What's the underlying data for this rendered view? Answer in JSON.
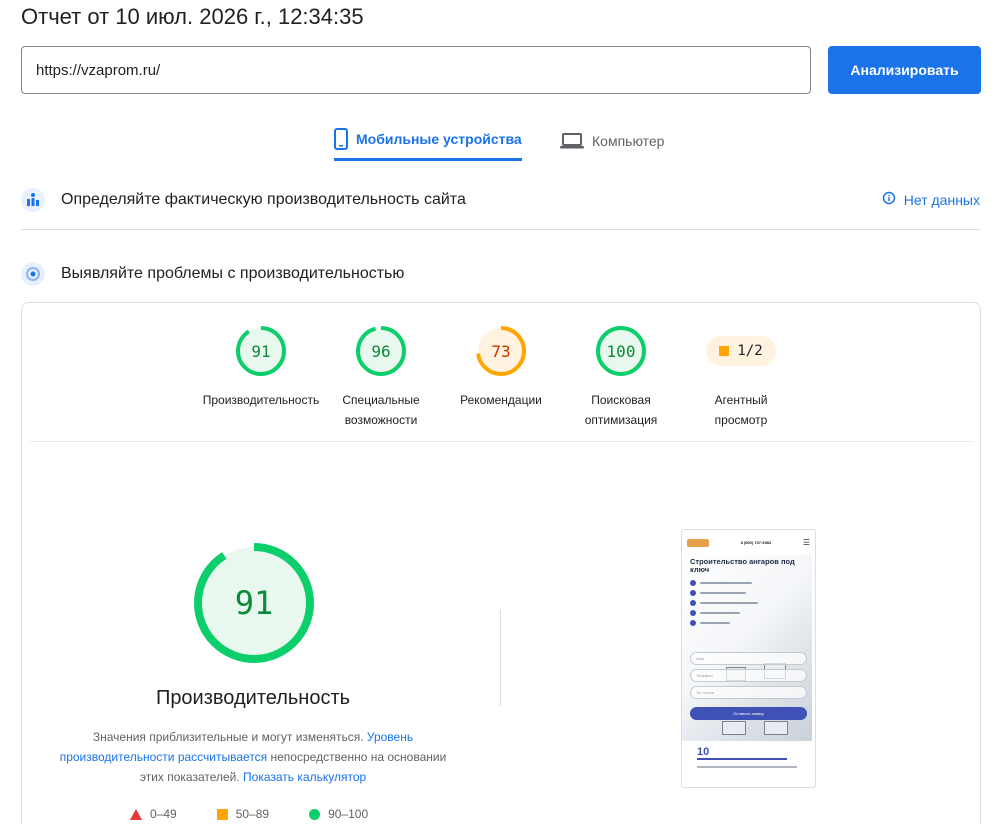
{
  "report": {
    "title": "Отчет от 10 июл. 2026 г., 12:34:35"
  },
  "search": {
    "url": "https://vzaprom.ru/",
    "analyze_label": "Анализировать"
  },
  "tabs": [
    {
      "label": "Мобильные устройства",
      "icon": "smartphone-icon",
      "active": true
    },
    {
      "label": "Компьютер",
      "icon": "laptop-icon",
      "active": false
    }
  ],
  "field_data": {
    "title": "Определяйте фактическую производительность сайта",
    "status": "Нет данных"
  },
  "lab_data": {
    "title": "Выявляйте проблемы с производительностью"
  },
  "scores": [
    {
      "value": "91",
      "label_lines": [
        "Производительность"
      ],
      "score": 91,
      "color": "#0cce6b",
      "text_color": "#0a8a3a",
      "bg": "#e8f8ee"
    },
    {
      "value": "96",
      "label_lines": [
        "Специальные",
        "возможности"
      ],
      "score": 96,
      "color": "#0cce6b",
      "text_color": "#0a8a3a",
      "bg": "#e8f8ee"
    },
    {
      "value": "73",
      "label_lines": [
        "Рекомендации"
      ],
      "score": 73,
      "color": "#ffa400",
      "text_color": "#c33300",
      "bg": "#fff3e0"
    },
    {
      "value": "100",
      "label_lines": [
        "Поисковая",
        "оптимизация"
      ],
      "score": 100,
      "color": "#0cce6b",
      "text_color": "#0a8a3a",
      "bg": "#e8f8ee"
    }
  ],
  "agent": {
    "value": "1/2",
    "label_lines": [
      "Агентный",
      "просмотр"
    ]
  },
  "performance": {
    "score": "91",
    "score_num": 91,
    "title": "Производительность",
    "note_text1": "Значения приблизительные и могут изменяться. ",
    "note_link1": "Уровень производительности рассчитывается",
    "note_text2": " непосредственно на основании этих показателей. ",
    "note_link2": "Показать калькулятор"
  },
  "legend": [
    {
      "label": "0–49",
      "shape": "triangle",
      "color": "#e53935"
    },
    {
      "label": "50–89",
      "shape": "square",
      "color": "#ffa400"
    },
    {
      "label": "90–100",
      "shape": "circle",
      "color": "#0cce6b"
    }
  ],
  "screenshot": {
    "phone_text": "8 (800) 707-6984",
    "heading": "Строительство ангаров под ключ",
    "fields": [
      "Имя",
      "Телефон",
      "Эл. почта"
    ],
    "button": "Оставить заявку",
    "stat": "10"
  }
}
